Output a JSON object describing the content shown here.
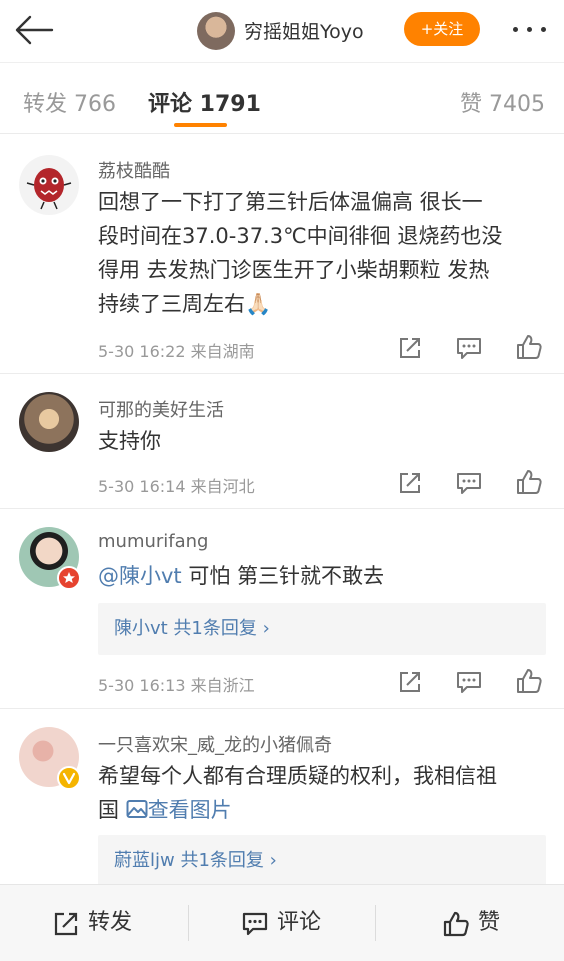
{
  "header": {
    "author_name": "穷摇姐姐Yoyo",
    "follow_label": "+关注"
  },
  "tabs": {
    "repost_label": "转发 766",
    "comment_label": "评论 1791",
    "like_label": "赞 7405"
  },
  "comments": [
    {
      "name": "荔枝酷酷",
      "lines": [
        "回想了一下打了第三针后体温偏高 很长一",
        "段时间在37.0-37.3℃中间徘徊 退烧药也没",
        "得用 去发热门诊医生开了小柴胡颗粒 发热",
        "持续了三周左右🙏🏻"
      ],
      "meta": "5-30 16:22 来自湖南"
    },
    {
      "name": "可那的美好生活",
      "text": "支持你",
      "meta": "5-30 16:14 来自河北"
    },
    {
      "name": "mumurifang",
      "mention": "@陳小vt",
      "text": " 可怕 第三针就不敢去",
      "reply": "陳小vt 共1条回复 ›",
      "meta": "5-30 16:13 来自浙江"
    },
    {
      "name": "一只喜欢宋_威_龙的小猪佩奇",
      "line1": "希望每个人都有合理质疑的权利，我相信祖",
      "line2_text": "国 ",
      "line2_link": "查看图片",
      "reply": "蔚蓝ljw 共1条回复 ›"
    }
  ],
  "bottom_bar": {
    "repost": "转发",
    "comment": "评论",
    "like": "赞"
  }
}
